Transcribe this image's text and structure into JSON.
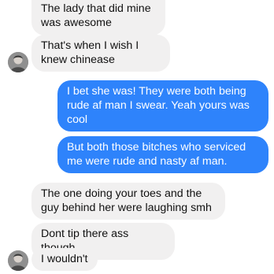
{
  "thread": {
    "messages": [
      {
        "sender": "them",
        "text": "The lady that did mine was awesome"
      },
      {
        "sender": "them",
        "text": "That's when I wish I knew chinease"
      },
      {
        "sender": "me",
        "text": "I bet she was! They were both being rude af man I swear. Yeah yours was cool"
      },
      {
        "sender": "me",
        "text": "But both those bitches who serviced me were rude and nasty af man."
      },
      {
        "sender": "them",
        "text": "The one doing your toes and the guy behind her were laughing smh"
      },
      {
        "sender": "them",
        "text": "Dont tip there ass though"
      },
      {
        "sender": "them",
        "text": "I wouldn't"
      }
    ],
    "colors": {
      "incoming_bubble": "#f1f0f0",
      "outgoing_bubble": "#2e83fb",
      "incoming_text": "#111111",
      "outgoing_text": "#ffffff"
    },
    "avatar_icon": "user-avatar-icon"
  }
}
